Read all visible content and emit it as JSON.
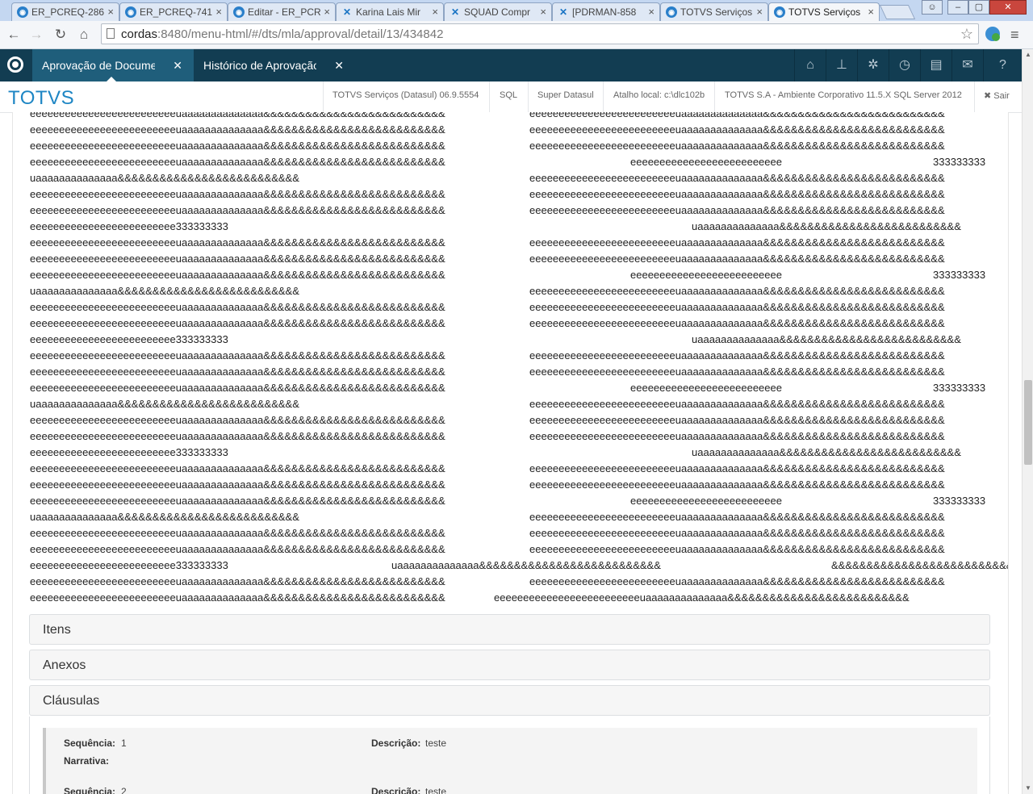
{
  "browser": {
    "tabs": [
      {
        "title": "ER_PCREQ-286",
        "icon": "circle-icon"
      },
      {
        "title": "ER_PCREQ-741",
        "icon": "circle-icon"
      },
      {
        "title": "Editar - ER_PCR",
        "icon": "circle-icon"
      },
      {
        "title": "Karina Lais Mir",
        "icon": "jira-icon"
      },
      {
        "title": "SQUAD Compr",
        "icon": "jira-icon"
      },
      {
        "title": "[PDRMAN-858",
        "icon": "jira-icon"
      },
      {
        "title": "TOTVS Serviços",
        "icon": "circle-icon"
      },
      {
        "title": "TOTVS Serviços",
        "icon": "circle-icon"
      }
    ],
    "url_host": "cordas",
    "url_rest": ":8480/menu-html/#/dts/mla/approval/detail/13/434842"
  },
  "app": {
    "tabs": [
      {
        "label": "Aprovação de Docume"
      },
      {
        "label": "Histórico de Aprovação"
      }
    ],
    "brand": "TOTVS",
    "info": {
      "company": "TOTVS Serviços (Datasul) 06.9.5554",
      "db": "SQL",
      "user": "Super Datasul",
      "shortcut": "Atalho local: c:\\dlc102b",
      "env": "TOTVS S.A - Ambiente Corporativo 11.5.X SQL Server 2012",
      "logout": "✖ Sair"
    },
    "header_icons": [
      "home-icon",
      "sitemap-icon",
      "gear-icon",
      "clock-icon",
      "document-icon",
      "mail-icon",
      "help-icon"
    ]
  },
  "note": {
    "pat_ea": "eeeeeeeeeeeeeeeeeeeeeeeeeuaaaaaaaaaaaaaa&&&&&&&&&&&&&&&&&&&&&&&&&&",
    "pat_e3": "eeeeeeeeeeeeeeeeeeeeeeeee333333333",
    "pat_ua": "uaaaaaaaaaaaaaa&&&&&&&&&&&&&&&&&&&&&&&&&&",
    "pat_e": "eeeeeeeeeeeeeeeeeeeeeeeeee",
    "pat_3": "333333333",
    "pat_amp": "&&&&&&&&&&&&&&&&&&&&&&&&&&"
  },
  "sections": {
    "items": "Itens",
    "attachments": "Anexos",
    "clauses": "Cláusulas"
  },
  "clauses": [
    {
      "seq_label": "Sequência:",
      "seq": "1",
      "desc_label": "Descrição:",
      "desc": "teste",
      "narr_label": "Narrativa:"
    },
    {
      "seq_label": "Sequência:",
      "seq": "2",
      "desc_label": "Descrição:",
      "desc": "teste"
    }
  ]
}
